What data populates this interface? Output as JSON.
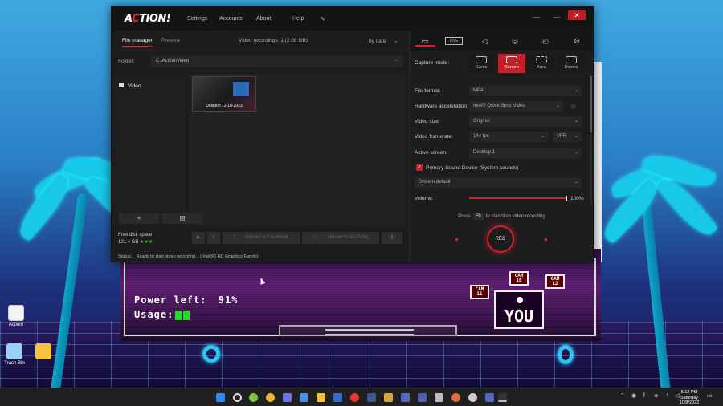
{
  "app": {
    "menu": [
      "Settings",
      "Accounts",
      "About",
      "Help"
    ],
    "window_controls": [
      "—",
      "—",
      "✕"
    ],
    "tabs": {
      "file_manager": "File manager",
      "preview": "Preview"
    },
    "recordings_summary": "Video recordings: 1 (2.08 GB)",
    "sort": "by date",
    "folder_label": "Folder:",
    "folder_path": "C:\\Action\\Video",
    "folder_more": "...",
    "sidebar_items": [
      "Video"
    ],
    "add_label": "+",
    "thumbnail_label": "Desktop 12-18-2023",
    "free_disk_label": "Free disk space",
    "free_disk_value": "121.4 GB",
    "free_disk_stars": "★★★",
    "toolbar": {
      "upload_facebook": "Upload to Facebook",
      "upload_youtube": "Upload to YouTube"
    },
    "status_label": "Status:",
    "status_text": "Ready to start video recording... (Intel(R) HD Graphics Family)"
  },
  "panel": {
    "capture_mode_label": "Capture mode:",
    "capture_modes": [
      "Game",
      "Screen",
      "Area",
      "Device"
    ],
    "active_mode": "Screen",
    "live_label": "LIVE",
    "file_format_label": "File format:",
    "file_format": "MP4",
    "hw_accel_label": "Hardware acceleration:",
    "hw_accel": "Intel® Quick Sync Video",
    "video_size_label": "Video size:",
    "video_size": "Original",
    "framerate_label": "Video framerate:",
    "framerate": "144 fps",
    "framerate_mode": "VFR",
    "active_screen_label": "Active screen:",
    "active_screen": "Desktop 1",
    "sound_device": "Primary Sound Device (System sounds)",
    "sound_source": "System default",
    "volume_label": "Volume:",
    "volume": "100%",
    "hotkey_prefix": "Press",
    "hotkey_key": "F9",
    "hotkey_suffix": "to start/stop video recording",
    "rec_label": "REC"
  },
  "game": {
    "power_label": "Power left:",
    "power_value": "91%",
    "usage_label": "Usage:",
    "usage_bars": 2,
    "cams": [
      [
        "CAM",
        "11"
      ],
      [
        "CAM",
        "10"
      ],
      [
        "CAM",
        "12"
      ]
    ],
    "you_label": "YOU"
  },
  "desktop": {
    "icons": [
      "Action!",
      "Trash Bin"
    ]
  },
  "taskbar": {
    "clock_time": "5:12 PM",
    "clock_day": "Saturday",
    "clock_date": "10/8/2022"
  },
  "colors": {
    "accent": "#e0212d",
    "panel_bg": "#1d1d1d",
    "success": "#2ecc2e"
  }
}
